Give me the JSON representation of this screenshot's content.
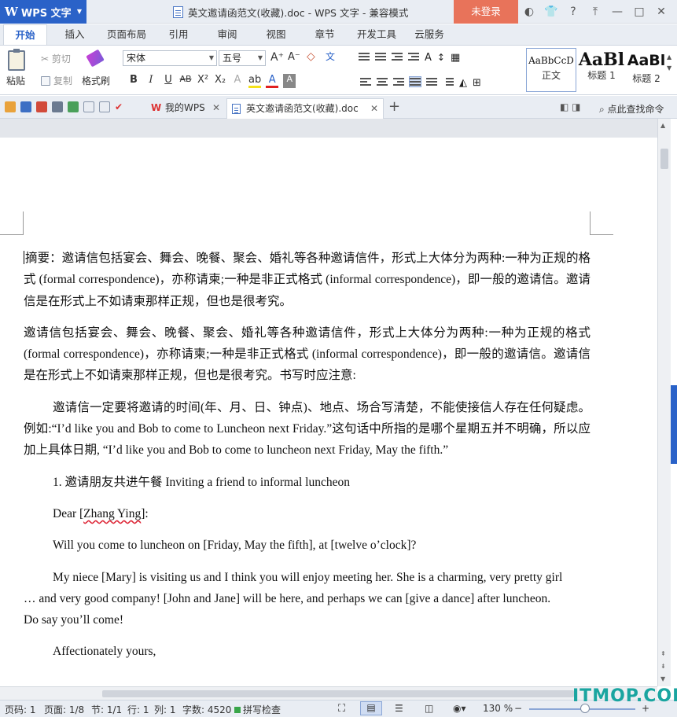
{
  "titlebar": {
    "app_name": "WPS 文字",
    "doc_title": "英文邀请函范文(收藏).doc - WPS 文字 - 兼容模式",
    "login": "未登录",
    "controls": [
      "◐",
      "👕",
      "?",
      "⤒",
      "—",
      "□",
      "✕"
    ]
  },
  "menu": [
    "开始",
    "插入",
    "页面布局",
    "引用",
    "审阅",
    "视图",
    "章节",
    "开发工具",
    "云服务"
  ],
  "ribbon": {
    "paste": "粘贴",
    "cut": "剪切",
    "copy": "复制",
    "format_painter": "格式刷",
    "font_name": "宋体",
    "font_size": "五号",
    "bold": "B",
    "italic": "I",
    "underline": "U",
    "strike": "AB",
    "superscript": "X²",
    "subscript": "X₂",
    "grow": "A⁺",
    "shrink": "A⁻",
    "wen": "文",
    "styles": [
      {
        "sample": "AaBbCcD",
        "name": "正文"
      },
      {
        "sample": "AaBl",
        "name": "标题 1"
      },
      {
        "sample": "AaBl",
        "name": "标题 2"
      }
    ]
  },
  "tabs": {
    "mywps": "我的WPS",
    "doc": "英文邀请函范文(收藏).doc",
    "find": "点此查找命令"
  },
  "document": {
    "p1": "摘要：邀请信包括宴会、舞会、晚餐、聚会、婚礼等各种邀请信件，形式上大体分为两种:一种为正规的格式 (formal correspondence)，亦称请柬;一种是非正式格式 (informal correspondence)，即一般的邀请信。邀请信是在形式上不如请柬那样正规，但也是很考究。",
    "p2": "邀请信包括宴会、舞会、晚餐、聚会、婚礼等各种邀请信件，形式上大体分为两种:一种为正规的格式 (formal correspondence)，亦称请柬;一种是非正式格式 (informal correspondence)，即一般的邀请信。邀请信是在形式上不如请柬那样正规，但也是很考究。书写时应注意:",
    "p3": "邀请信一定要将邀请的时间(年、月、日、钟点)、地点、场合写清楚，不能使接信人存在任何疑虑。例如:“I’d like you and Bob to come to Luncheon next Friday.”这句话中所指的是哪个星期五并不明确，所以应加上具体日期, “I’d like you and Bob to come to luncheon next Friday, May the fifth.”",
    "p4": "1.  邀请朋友共进午餐  Inviting a friend to informal luncheon",
    "p5_pre": "Dear [",
    "p5_name": "Zhang Ying",
    "p5_post": "]:",
    "p6": "Will you come to luncheon on [Friday, May the fifth], at [twelve o’clock]?",
    "p7": "My niece [Mary] is visiting us and I think you will enjoy meeting her. She is a charming, very pretty girl … and very good company! [John and Jane] will be here, and perhaps we can [give a dance] after luncheon. Do say you’ll come!",
    "p8": "Affectionately yours,"
  },
  "status": {
    "page": "页码: 1",
    "pages": "页面: 1/8",
    "section": "节: 1/1",
    "row": "行: 1",
    "col": "列: 1",
    "words": "字数: 4520",
    "spell": "拼写检查",
    "zoom": "130 %",
    "minus": "−",
    "plus": "+"
  },
  "watermark": "ITMOP.COM"
}
